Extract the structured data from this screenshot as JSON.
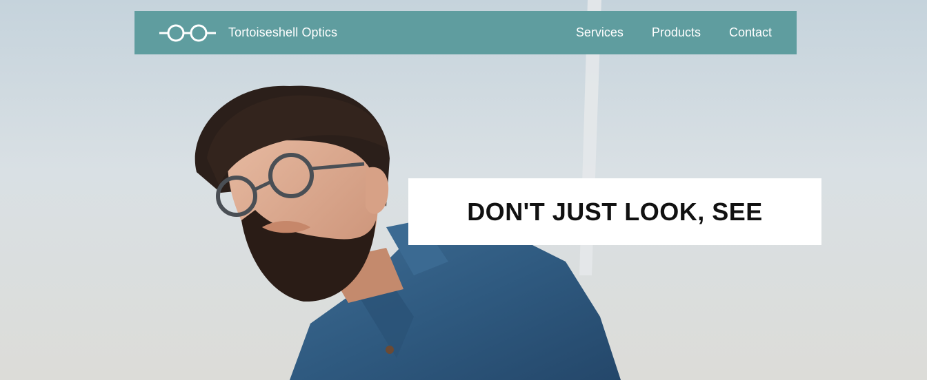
{
  "navbar": {
    "brand_name": "Tortoiseshell Optics",
    "logo_icon": "glasses-icon",
    "links": [
      {
        "label": "Services"
      },
      {
        "label": "Products"
      },
      {
        "label": "Contact"
      }
    ],
    "background_color": "#5f9d9f"
  },
  "hero": {
    "headline": "DON'T JUST LOOK, SEE",
    "image_subject": "bearded-man-wearing-glasses-in-denim-shirt"
  }
}
